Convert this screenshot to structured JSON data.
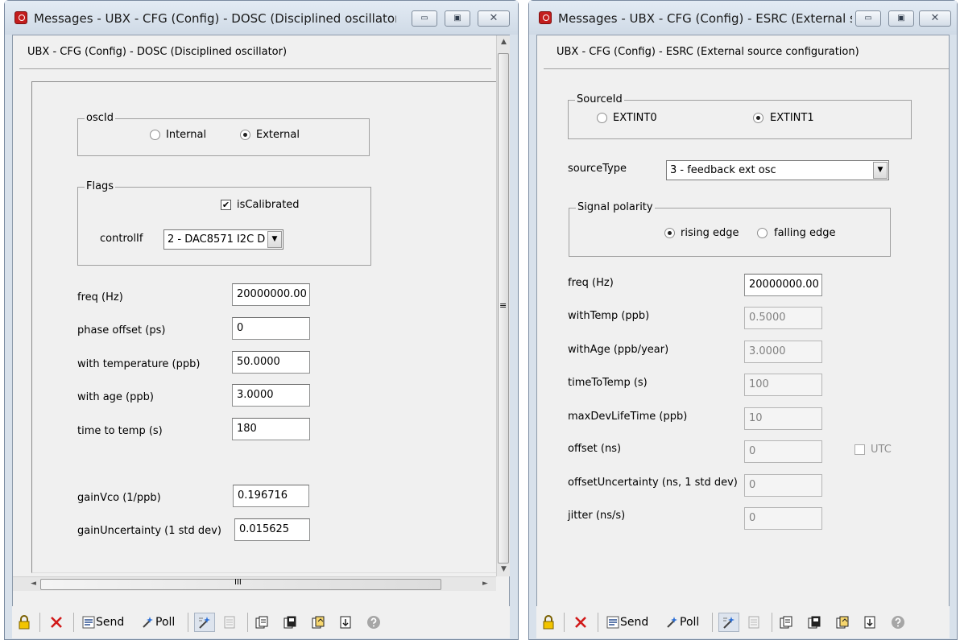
{
  "left_window": {
    "title": "Messages - UBX - CFG (Config) - DOSC (Disciplined oscillator)",
    "header": "UBX - CFG (Config) - DOSC (Disciplined oscillator)",
    "oscId": {
      "legend": "oscId",
      "options": [
        "Internal",
        "External"
      ],
      "selected": "External"
    },
    "flags": {
      "legend": "Flags",
      "isCalibrated_label": "isCalibrated",
      "isCalibrated_checked": true,
      "controlIf_label": "controlIf",
      "controlIf_value": "2  - DAC8571 I2C D"
    },
    "fields": [
      {
        "label": "freq (Hz)",
        "value": "20000000.00"
      },
      {
        "label": "phase offset (ps)",
        "value": "0"
      },
      {
        "label": "with temperature (ppb)",
        "value": "50.0000"
      },
      {
        "label": "with age (ppb)",
        "value": "3.0000"
      },
      {
        "label": "time to temp (s)",
        "value": "180"
      },
      {
        "label": "gainVco (1/ppb)",
        "value": "0.196716"
      },
      {
        "label": "gainUncertainty (1 std dev)",
        "value": "0.015625"
      }
    ]
  },
  "right_window": {
    "title": "Messages - UBX - CFG (Config) - ESRC (External sou...",
    "header": "UBX - CFG (Config) - ESRC (External source configuration)",
    "sourceId": {
      "legend": "SourceId",
      "options": [
        "EXTINT0",
        "EXTINT1"
      ],
      "selected": "EXTINT1"
    },
    "sourceType": {
      "label": "sourceType",
      "value": "3 - feedback ext osc"
    },
    "polarity": {
      "legend": "Signal polarity",
      "options": [
        "rising edge",
        "falling edge"
      ],
      "selected": "rising edge"
    },
    "fields": [
      {
        "label": "freq (Hz)",
        "value": "20000000.00",
        "enabled": true
      },
      {
        "label": "withTemp (ppb)",
        "value": "0.5000",
        "enabled": false
      },
      {
        "label": "withAge (ppb/year)",
        "value": "3.0000",
        "enabled": false
      },
      {
        "label": "timeToTemp (s)",
        "value": "100",
        "enabled": false
      },
      {
        "label": "maxDevLifeTime (ppb)",
        "value": "10",
        "enabled": false
      },
      {
        "label": "offset (ns)",
        "value": "0",
        "enabled": false
      },
      {
        "label": "offsetUncertainty (ns, 1 std dev)",
        "value": "0",
        "enabled": false
      },
      {
        "label": "jitter (ns/s)",
        "value": "0",
        "enabled": false
      }
    ],
    "utc_label": "UTC"
  },
  "toolbar": {
    "send": "Send",
    "poll": "Poll"
  },
  "scroll": {
    "hthumb_glyph": "III",
    "vthumb_glyph": "≡"
  },
  "controls": {
    "minimize": "▭",
    "maximize": "▣",
    "close": "✕"
  },
  "icons": {
    "lock": "lock-icon",
    "cancel": "x-icon",
    "send": "send-icon",
    "poll": "poll-icon",
    "help": "help-icon"
  },
  "colors": {
    "titlebar": "#d8e1eb",
    "client": "#f0f0f0",
    "cancel": "#d11a1a",
    "lock": "#e8b800"
  }
}
